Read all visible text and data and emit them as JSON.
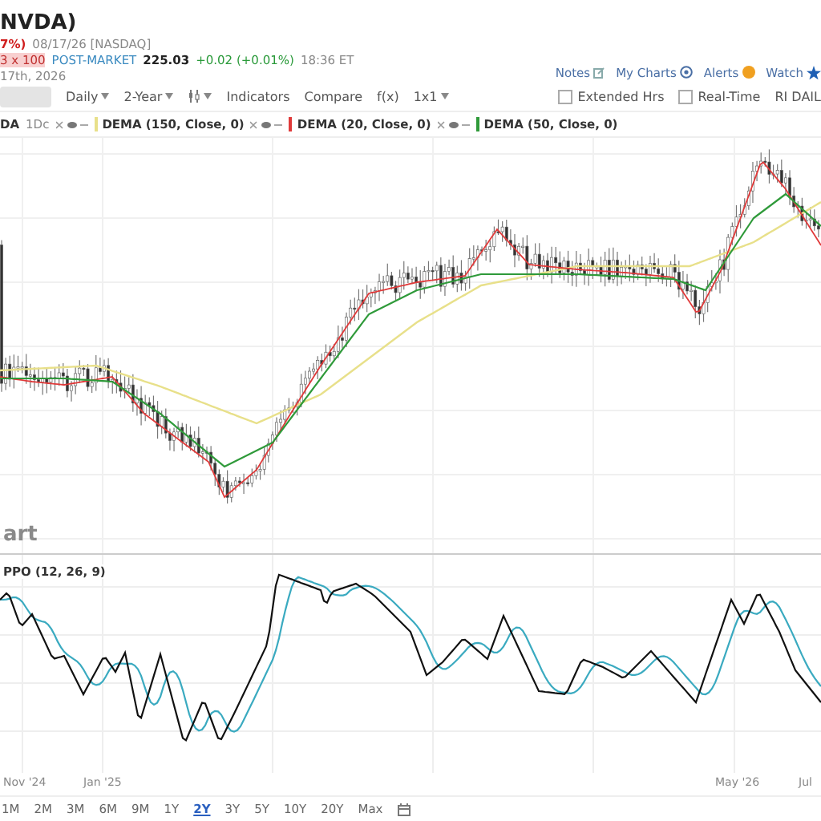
{
  "header": {
    "symbol_title": "NVDA)",
    "change_pct": "7%)",
    "quote_date": "08/17/26 [NASDAQ]",
    "size_badge": "3 x 100",
    "post_market_label": "POST-MARKET",
    "post_market_price": "225.03",
    "post_market_change": "+0.02 (+0.01%)",
    "post_market_time": "18:36 ET",
    "date_line": "17th, 2026"
  },
  "header_links": [
    {
      "label": "Notes",
      "kind": "notes"
    },
    {
      "label": "My Charts",
      "kind": "charts"
    },
    {
      "label": "Alerts",
      "kind": "alerts"
    },
    {
      "label": "Watch",
      "kind": "watch"
    }
  ],
  "toolbar": [
    {
      "kind": "dropdown",
      "label": "Daily"
    },
    {
      "kind": "dropdown",
      "label": "2-Year"
    },
    {
      "kind": "icon-dropdown"
    },
    {
      "kind": "button",
      "label": "Indicators"
    },
    {
      "kind": "button",
      "label": "Compare"
    },
    {
      "kind": "button",
      "label": "f(x)"
    },
    {
      "kind": "dropdown",
      "label": "1x1"
    }
  ],
  "toolbar_options": [
    {
      "label": "Extended Hrs",
      "checked": false
    },
    {
      "label": "Real-Time",
      "checked": false
    }
  ],
  "toolbar_extra": "RI DAIL",
  "legend": {
    "symbol": "DA",
    "interval": "1Dc",
    "overlays": [
      {
        "label": "DEMA (150, Close, 0)",
        "color": "#e8e08a"
      },
      {
        "label": "DEMA (20, Close, 0)",
        "color": "#e03a3a"
      },
      {
        "label": "DEMA (50, Close, 0)",
        "color": "#2f9a3a"
      }
    ]
  },
  "price_chart": {
    "logo": "art"
  },
  "indicator": {
    "label": "PPO (12, 26, 9)"
  },
  "x_axis_labels": [
    "Nov '24",
    "Jan '25",
    "May '26",
    "Jul"
  ],
  "ranges": [
    {
      "label": "1M",
      "selected": false
    },
    {
      "label": "2M",
      "selected": false
    },
    {
      "label": "3M",
      "selected": false
    },
    {
      "label": "6M",
      "selected": false
    },
    {
      "label": "9M",
      "selected": false
    },
    {
      "label": "1Y",
      "selected": false
    },
    {
      "label": "2Y",
      "selected": true
    },
    {
      "label": "3Y",
      "selected": false
    },
    {
      "label": "5Y",
      "selected": false
    },
    {
      "label": "10Y",
      "selected": false
    },
    {
      "label": "20Y",
      "selected": false
    },
    {
      "label": "Max",
      "selected": false
    }
  ]
}
